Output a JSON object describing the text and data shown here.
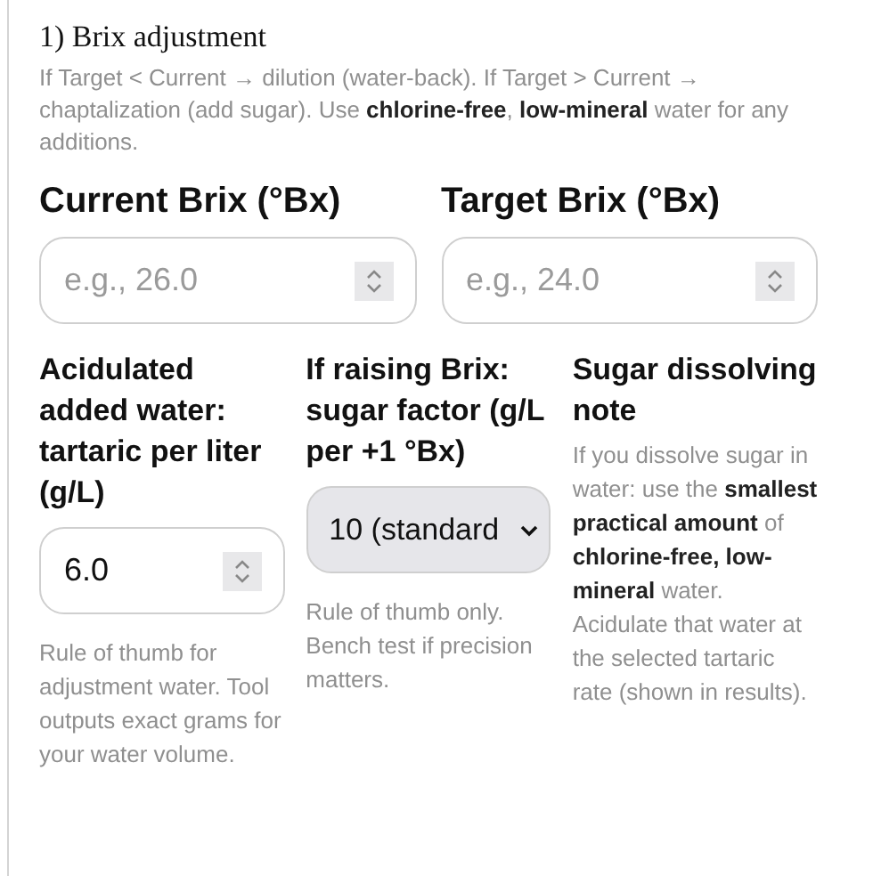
{
  "section": {
    "title": "1) Brix adjustment",
    "description": "If Target < Current → dilution (water-back). If Target > Current → chaptalization (add sugar). Use **chlorine-free**, **low-mineral** water for any additions.",
    "top_fields": [
      {
        "label": "Current Brix (°Bx)",
        "kind": "number",
        "placeholder": "e.g., 26.0"
      },
      {
        "label": "Target Brix (°Bx)",
        "kind": "number",
        "placeholder": "e.g., 24.0"
      }
    ],
    "bottom_fields": [
      {
        "label": "Acidulated added water: tartaric per liter (g/L)",
        "kind": "number",
        "value": "6.0",
        "help": "Rule of thumb for adjustment water. Tool outputs exact grams for your water volume."
      },
      {
        "label": "If raising Brix: sugar factor (g/L per +1 °Bx)",
        "kind": "select",
        "value": "10 (standard",
        "help": "Rule of thumb only. Bench test if precision matters."
      },
      {
        "label": "Sugar dissolving note",
        "kind": "note",
        "help": "If you dissolve sugar in water: use the **smallest practical amount** of **chlorine-free, low-mineral** water. Acidulate that water at the selected tartaric rate (shown in results)."
      }
    ]
  }
}
